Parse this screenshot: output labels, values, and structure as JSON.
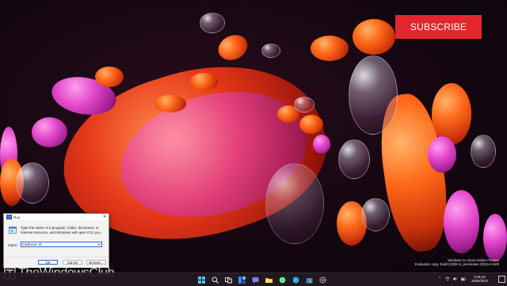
{
  "promo": {
    "subscribe_label": "SUBSCRIBE"
  },
  "run_dialog": {
    "title": "Run",
    "close_glyph": "✕",
    "description": "Type the name of a program, folder, document, or Internet resource, and Windows will open it for you.",
    "open_label": "Open:",
    "input_value": "msdt.exe -id",
    "ok_label": "OK",
    "cancel_label": "Cancel",
    "browse_label": "Browse..."
  },
  "watermark": {
    "site_name": "TheWindowsClub"
  },
  "build_info": {
    "line1": "Windows 11 Home Insider Preview",
    "line2": "Evaluation copy. Build 22538.rs_prerelease.220114-1500"
  },
  "taskbar": {
    "icons": [
      "windows-start-icon",
      "search-icon",
      "task-view-icon",
      "widgets-icon",
      "teams-chat-icon",
      "file-explorer-icon",
      "whatsapp-icon",
      "edge-icon",
      "store-icon",
      "settings-icon"
    ],
    "time": "2:28 pm",
    "date": "25/05/2022"
  },
  "colors": {
    "subscribe_red": "#e3262b",
    "dialog_accent": "#2c62c8",
    "taskbar_bg": "#241a22"
  }
}
